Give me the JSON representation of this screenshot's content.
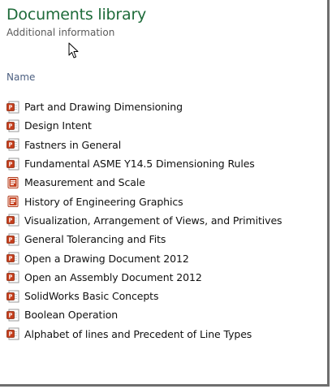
{
  "header": {
    "title": "Documents library",
    "subtitle": "Additional information"
  },
  "columns": {
    "name": "Name"
  },
  "documents": [
    {
      "label": "Part and Drawing Dimensioning",
      "icon": "ppt-icon"
    },
    {
      "label": "Design Intent",
      "icon": "ppt-icon"
    },
    {
      "label": "Fastners in General",
      "icon": "ppt-icon"
    },
    {
      "label": "Fundamental ASME Y14.5 Dimensioning Rules",
      "icon": "ppt-icon"
    },
    {
      "label": "Measurement and Scale",
      "icon": "ppt-show-icon"
    },
    {
      "label": "History of Engineering Graphics",
      "icon": "ppt-show-icon"
    },
    {
      "label": "Visualization, Arrangement of Views, and Primitives",
      "icon": "ppt-icon"
    },
    {
      "label": "General Tolerancing and Fits",
      "icon": "ppt-icon"
    },
    {
      "label": "Open a Drawing Document 2012",
      "icon": "ppt-icon"
    },
    {
      "label": "Open an Assembly Document 2012",
      "icon": "ppt-icon"
    },
    {
      "label": "SolidWorks Basic Concepts",
      "icon": "ppt-icon"
    },
    {
      "label": "Boolean Operation",
      "icon": "ppt-icon"
    },
    {
      "label": "Alphabet of lines and Precedent of Line Types",
      "icon": "ppt-icon"
    }
  ],
  "colors": {
    "title": "#1e6b3a",
    "subtitle": "#5a5a5a",
    "column_header": "#4d6081",
    "ppt_icon_red": "#c43e1c",
    "frame_border": "#6e6e6e"
  }
}
